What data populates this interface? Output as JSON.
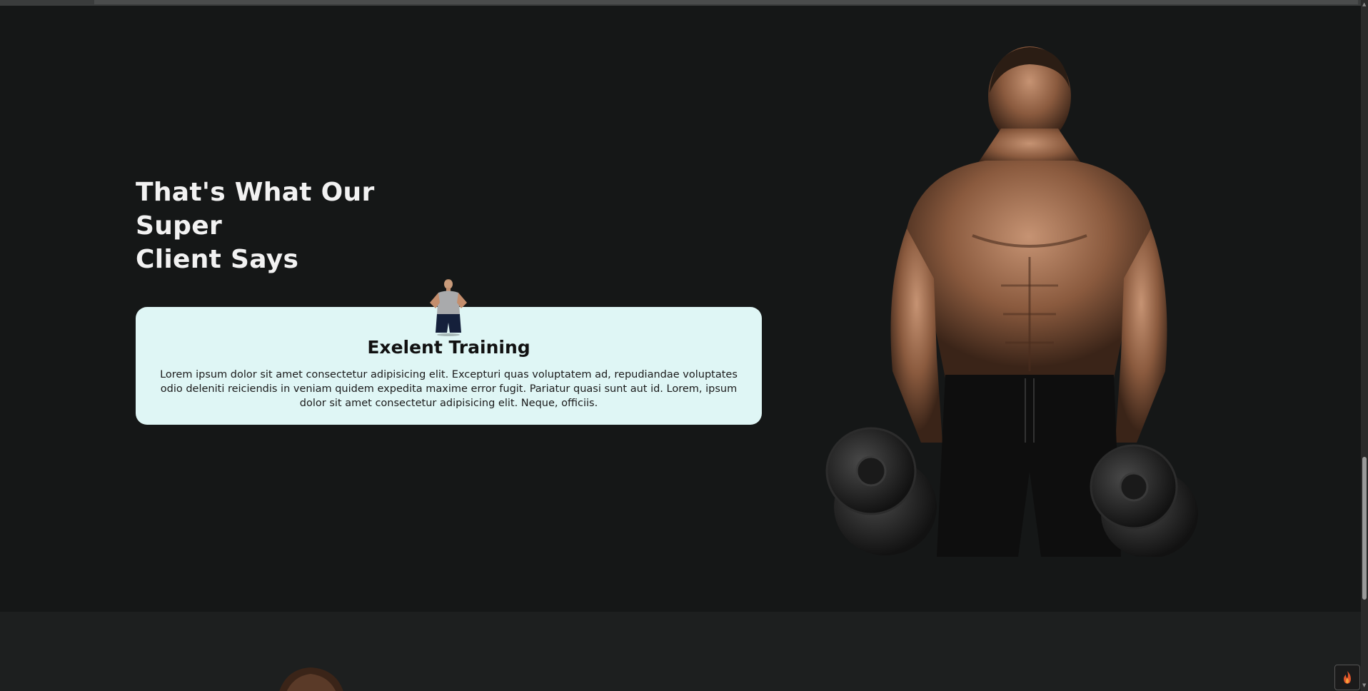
{
  "testimonials": {
    "heading_line1": "That's What Our Super",
    "heading_line2": "Client Says",
    "card": {
      "title": "Exelent Training",
      "text": "Lorem ipsum dolor sit amet consectetur adipisicing elit. Excepturi quas voluptatem ad, repudiandae voluptates odio deleniti reiciendis in veniam quidem expedita maxime error fugit. Pariatur quasi sunt aut id. Lorem, ipsum dolor sit amet consectetur adipisicing elit. Neque, officiis."
    }
  },
  "icons": {
    "avatar": "client-avatar-icon",
    "hero": "bodybuilder-with-dumbbells-image",
    "widget": "flame-icon"
  },
  "colors": {
    "background": "#151717",
    "card": "#dff6f5",
    "heading": "#f2f2f2"
  }
}
